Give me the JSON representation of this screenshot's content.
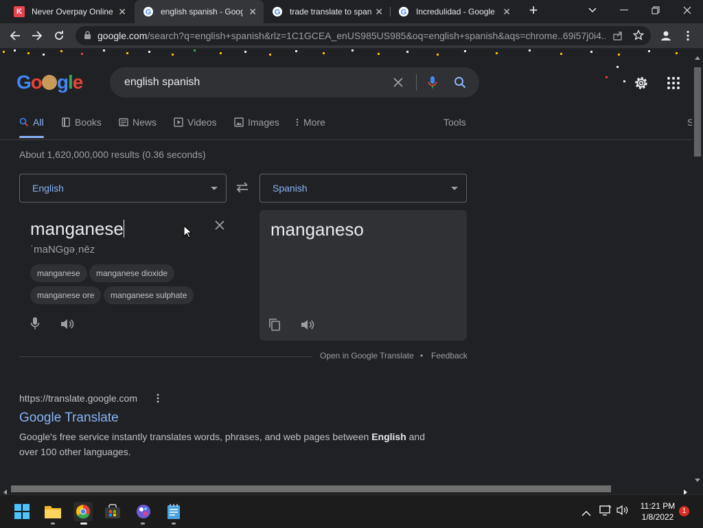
{
  "browser": {
    "tabs": [
      {
        "title": "Never Overpay Online"
      },
      {
        "title": "english spanish - Goog"
      },
      {
        "title": "trade translate to spani"
      },
      {
        "title": "Incredulidad - Google"
      }
    ],
    "address": {
      "domain": "google.com",
      "path": "/search?q=english+spanish&rlz=1C1GCEA_enUS985US985&oq=english+spanish&aqs=chrome..69i57j0i4..."
    }
  },
  "search": {
    "query": "english spanish",
    "nav": [
      {
        "label": "All",
        "icon": "search-icon"
      },
      {
        "label": "Books",
        "icon": "book-icon"
      },
      {
        "label": "News",
        "icon": "news-icon"
      },
      {
        "label": "Videos",
        "icon": "play-icon"
      },
      {
        "label": "Images",
        "icon": "image-icon"
      },
      {
        "label": "More",
        "icon": "kebab-icon"
      }
    ],
    "tools_label": "Tools",
    "edge_label": "S",
    "results_count": "About 1,620,000,000 results (0.36 seconds)"
  },
  "translate": {
    "source_lang": "English",
    "target_lang": "Spanish",
    "source_text": "manganese",
    "phonetic": "ˈmaNGgəˌnēz",
    "target_text": "manganeso",
    "suggestions": [
      "manganese",
      "manganese dioxide",
      "manganese ore",
      "manganese sulphate"
    ],
    "open_link": "Open in Google Translate",
    "separator": "•",
    "feedback": "Feedback"
  },
  "result": {
    "url": "https://translate.google.com",
    "title": "Google Translate",
    "snippet_before": "Google's free service instantly translates words, phrases, and web pages between ",
    "snippet_bold": "English",
    "snippet_after": " and over 100 other languages."
  },
  "taskbar": {
    "time": "11:21 PM",
    "date": "1/8/2022",
    "notifications": "1"
  },
  "colors": {
    "accent_link": "#8ab4f8",
    "page_bg": "#202124",
    "surface": "#303134",
    "notify": "#d93025"
  }
}
